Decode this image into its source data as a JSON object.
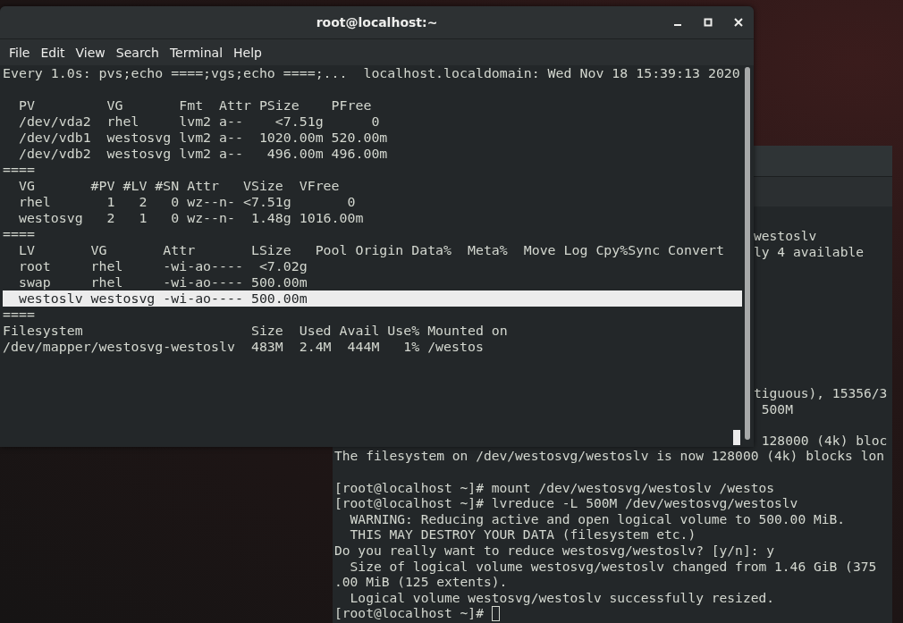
{
  "back_terminal": {
    "blocks": [
      {
        "kind": "partial",
        "lines": [
          "westoslv",
          "ly 4 available"
        ]
      },
      {
        "kind": "partial",
        "lines": [
          "tiguous), 15356/3",
          " 500M"
        ]
      },
      {
        "kind": "partial",
        "lines": [
          " 128000 (4k) bloc"
        ]
      },
      {
        "kind": "full",
        "lines": [
          "The filesystem on /dev/westosvg/westoslv is now 128000 (4k) blocks lon"
        ]
      },
      {
        "kind": "full",
        "lines": [
          "[root@localhost ~]# mount /dev/westosvg/westoslv /westos",
          "[root@localhost ~]# lvreduce -L 500M /dev/westosvg/westoslv",
          "  WARNING: Reducing active and open logical volume to 500.00 MiB.",
          "  THIS MAY DESTROY YOUR DATA (filesystem etc.)",
          "Do you really want to reduce westosvg/westoslv? [y/n]: y",
          "  Size of logical volume westosvg/westoslv changed from 1.46 GiB (375",
          ".00 MiB (125 extents).",
          "  Logical volume westosvg/westoslv successfully resized."
        ]
      }
    ],
    "prompt": "[root@localhost ~]# "
  },
  "window": {
    "title": "root@localhost:~"
  },
  "menu": [
    "File",
    "Edit",
    "View",
    "Search",
    "Terminal",
    "Help"
  ],
  "terminal": {
    "header": "Every 1.0s: pvs;echo ====;vgs;echo ====;...  localhost.localdomain: Wed Nov 18 15:39:13 2020",
    "lines": [
      {
        "text": "  PV         VG       Fmt  Attr PSize    PFree  ",
        "highlighted": false
      },
      {
        "text": "  /dev/vda2  rhel     lvm2 a--    <7.51g      0 ",
        "highlighted": false
      },
      {
        "text": "  /dev/vdb1  westosvg lvm2 a--  1020.00m 520.00m",
        "highlighted": false
      },
      {
        "text": "  /dev/vdb2  westosvg lvm2 a--   496.00m 496.00m",
        "highlighted": false
      },
      {
        "text": "====",
        "highlighted": false
      },
      {
        "text": "  VG       #PV #LV #SN Attr   VSize  VFree   ",
        "highlighted": false
      },
      {
        "text": "  rhel       1   2   0 wz--n- <7.51g       0 ",
        "highlighted": false
      },
      {
        "text": "  westosvg   2   1   0 wz--n-  1.48g 1016.00m",
        "highlighted": false
      },
      {
        "text": "====",
        "highlighted": false
      },
      {
        "text": "  LV       VG       Attr       LSize   Pool Origin Data%  Meta%  Move Log Cpy%Sync Convert",
        "highlighted": false
      },
      {
        "text": "  root     rhel     -wi-ao----  <7.02g",
        "highlighted": false
      },
      {
        "text": "  swap     rhel     -wi-ao---- 500.00m",
        "highlighted": false
      },
      {
        "text": "  westoslv westosvg -wi-ao---- 500.00m",
        "highlighted": true
      },
      {
        "text": "====",
        "highlighted": false
      },
      {
        "text": "Filesystem                     Size  Used Avail Use% Mounted on",
        "highlighted": false
      },
      {
        "text": "/dev/mapper/westosvg-westoslv  483M  2.4M  444M   1% /westos",
        "highlighted": false
      }
    ]
  }
}
